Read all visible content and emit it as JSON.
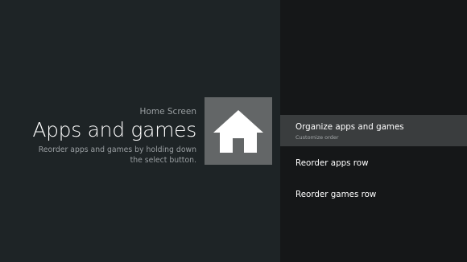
{
  "settings": {
    "section_label": "Home Screen",
    "title": "Apps and games",
    "description": "Reorder apps and games by holding down the select button.",
    "icon": "home-icon"
  },
  "menu": {
    "items": [
      {
        "label": "Organize apps and games",
        "sublabel": "Customize order",
        "selected": true
      },
      {
        "label": "Reorder apps row",
        "selected": false
      },
      {
        "label": "Reorder games row",
        "selected": false
      }
    ]
  },
  "colors": {
    "left_background": "#1e2426",
    "right_background": "#151718",
    "selected_item": "#3a3d3e",
    "icon_tile": "#636667"
  }
}
